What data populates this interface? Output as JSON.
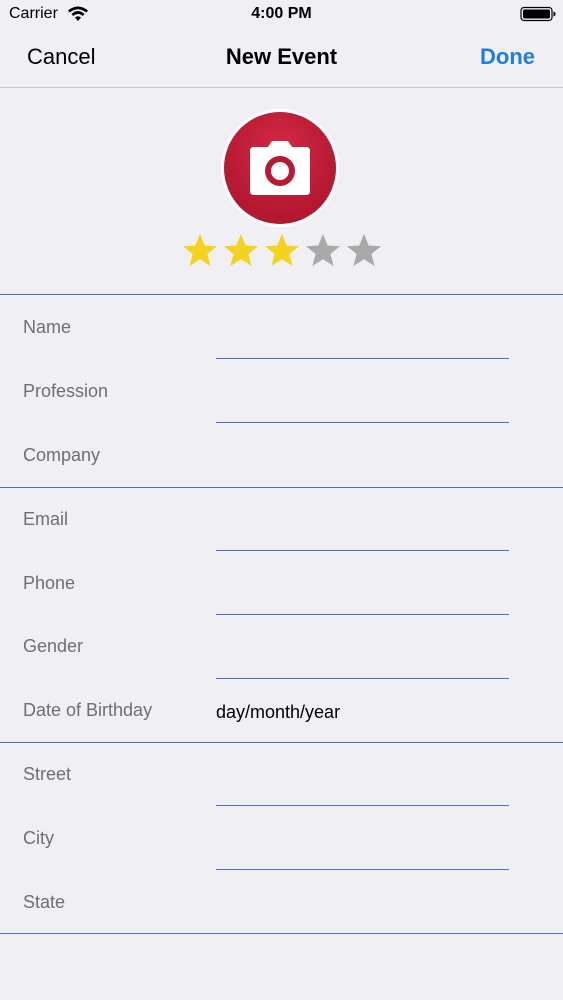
{
  "status_bar": {
    "carrier": "Carrier",
    "time": "4:00 PM"
  },
  "nav": {
    "cancel_label": "Cancel",
    "title": "New Event",
    "done_label": "Done"
  },
  "photo": {
    "icon": "camera-icon",
    "color": "#c21f3a"
  },
  "rating": {
    "value": 3,
    "max": 5,
    "filled_color": "#f4d21f",
    "empty_color": "#a9a9a9"
  },
  "sections": {
    "personal": {
      "name_label": "Name",
      "name_value": "",
      "profession_label": "Profession",
      "profession_value": "",
      "company_label": "Company",
      "company_value": ""
    },
    "contact": {
      "email_label": "Email",
      "email_value": "",
      "phone_label": "Phone",
      "phone_value": "",
      "gender_label": "Gender",
      "gender_value": "",
      "birthday_label": "Date of Birthday",
      "birthday_value": "day/month/year"
    },
    "address": {
      "street_label": "Street",
      "street_value": "",
      "city_label": "City",
      "city_value": "",
      "state_label": "State",
      "state_value": ""
    }
  },
  "colors": {
    "accent": "#1f7fe0",
    "separator": "#4a72c6",
    "background": "#efeff4"
  }
}
